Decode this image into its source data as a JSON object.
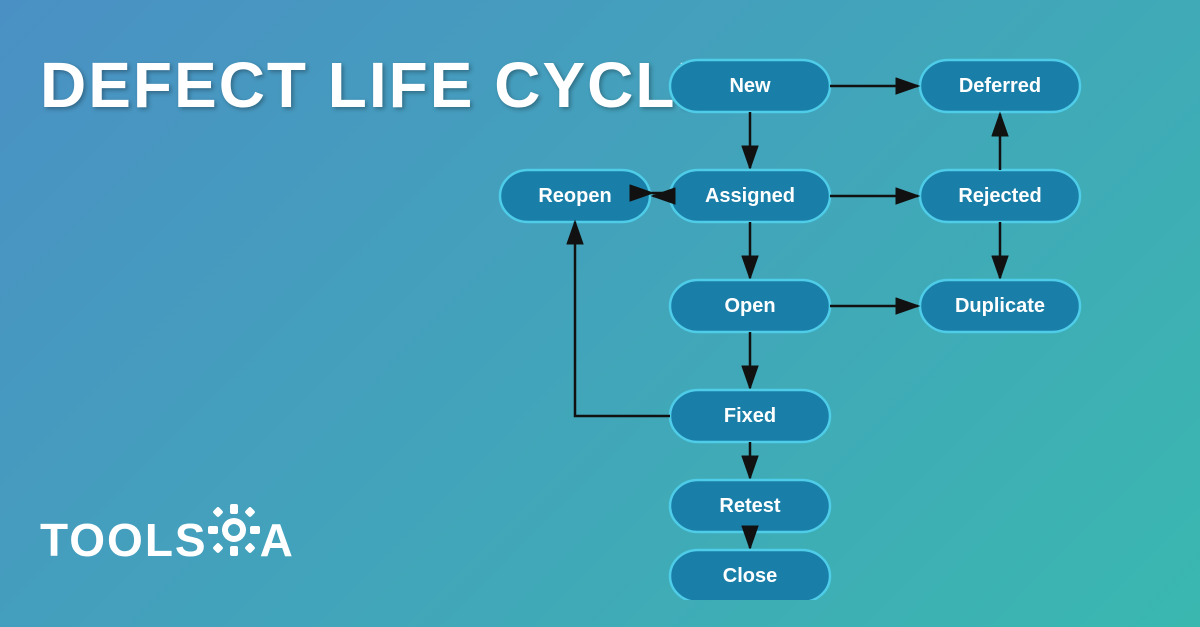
{
  "title": "DEFECT LIFE CYCLE",
  "logo": {
    "text_part1": "TOOLS",
    "text_part2": "A",
    "alt": "ToolsQA Logo"
  },
  "diagram": {
    "nodes": [
      {
        "id": "new",
        "label": "New"
      },
      {
        "id": "deferred",
        "label": "Deferred"
      },
      {
        "id": "assigned",
        "label": "Assigned"
      },
      {
        "id": "rejected",
        "label": "Rejected"
      },
      {
        "id": "reopen",
        "label": "Reopen"
      },
      {
        "id": "open",
        "label": "Open"
      },
      {
        "id": "duplicate",
        "label": "Duplicate"
      },
      {
        "id": "fixed",
        "label": "Fixed"
      },
      {
        "id": "retest",
        "label": "Retest"
      },
      {
        "id": "close",
        "label": "Close"
      }
    ]
  }
}
